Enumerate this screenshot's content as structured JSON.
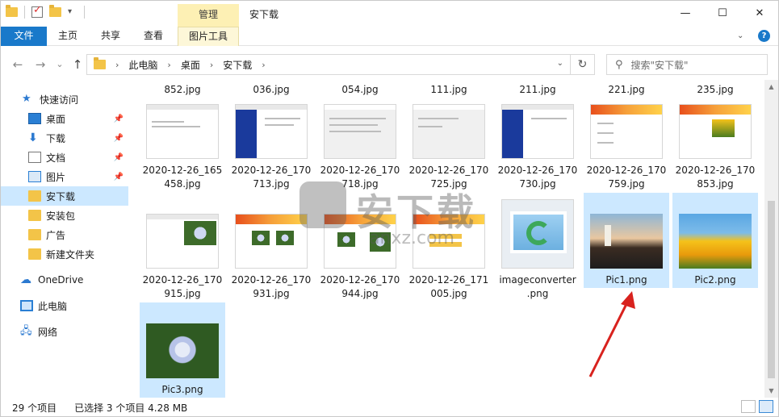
{
  "window": {
    "title": "安下载",
    "context_tab": "管理",
    "buttons": {
      "minimize": "—",
      "maximize": "☐",
      "close": "✕"
    }
  },
  "ribbon": {
    "tabs": [
      "文件",
      "主页",
      "共享",
      "查看",
      "图片工具"
    ]
  },
  "nav": {
    "back": "←",
    "forward": "→",
    "recent": "⌄",
    "up": "↑",
    "breadcrumbs": [
      "此电脑",
      "桌面",
      "安下载"
    ],
    "refresh": "↻",
    "search_placeholder": "搜索\"安下载\""
  },
  "sidebar": {
    "items": [
      {
        "label": "快速访问",
        "icon": "star-icon"
      },
      {
        "label": "桌面",
        "icon": "desktop-icon",
        "pinned": true
      },
      {
        "label": "下载",
        "icon": "download-icon",
        "pinned": true
      },
      {
        "label": "文档",
        "icon": "document-icon",
        "pinned": true
      },
      {
        "label": "图片",
        "icon": "pictures-icon",
        "pinned": true
      },
      {
        "label": "安下载",
        "icon": "folder-icon",
        "selected": true
      },
      {
        "label": "安装包",
        "icon": "folder-icon"
      },
      {
        "label": "广告",
        "icon": "folder-icon"
      },
      {
        "label": "新建文件夹",
        "icon": "folder-icon"
      },
      {
        "label": "OneDrive",
        "icon": "cloud-icon"
      },
      {
        "label": "此电脑",
        "icon": "computer-icon"
      },
      {
        "label": "网络",
        "icon": "network-icon"
      }
    ]
  },
  "files": {
    "top_row_labels": [
      "852.jpg",
      "036.jpg",
      "054.jpg",
      "111.jpg",
      "211.jpg",
      "221.jpg",
      "235.jpg"
    ],
    "row1": [
      {
        "line1": "2020-12-26_165",
        "line2": "458.jpg"
      },
      {
        "line1": "2020-12-26_170",
        "line2": "713.jpg"
      },
      {
        "line1": "2020-12-26_170",
        "line2": "718.jpg"
      },
      {
        "line1": "2020-12-26_170",
        "line2": "725.jpg"
      },
      {
        "line1": "2020-12-26_170",
        "line2": "730.jpg"
      },
      {
        "line1": "2020-12-26_170",
        "line2": "759.jpg"
      },
      {
        "line1": "2020-12-26_170",
        "line2": "853.jpg"
      }
    ],
    "row2": [
      {
        "line1": "2020-12-26_170",
        "line2": "915.jpg"
      },
      {
        "line1": "2020-12-26_170",
        "line2": "931.jpg"
      },
      {
        "line1": "2020-12-26_170",
        "line2": "944.jpg"
      },
      {
        "line1": "2020-12-26_171",
        "line2": "005.jpg"
      },
      {
        "line1": "imageconverter",
        "line2": ".png"
      },
      {
        "line1": "Pic1.png",
        "line2": "",
        "selected": true
      },
      {
        "line1": "Pic2.png",
        "line2": "",
        "selected": true
      }
    ],
    "row3": [
      {
        "line1": "Pic3.png",
        "line2": "",
        "selected": true
      }
    ]
  },
  "watermark": {
    "text": "安下载",
    "url": "anxz.com"
  },
  "status": {
    "count": "29 个项目",
    "selected": "已选择 3 个项目  4.28 MB"
  }
}
